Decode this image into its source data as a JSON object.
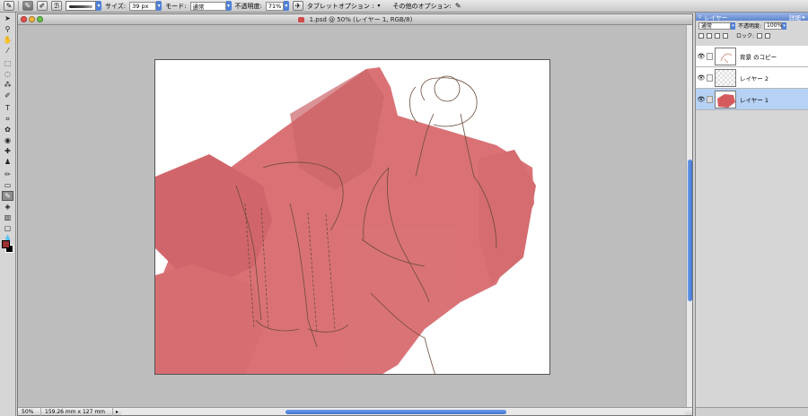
{
  "options_bar": {
    "size_label": "サイズ:",
    "size_value": "39 px",
    "mode_label": "モード:",
    "mode_value": "通常",
    "opacity_label": "不透明度:",
    "opacity_value": "71%",
    "tablet_label": "タブレットオプション :",
    "other_label": "その他のオプション:"
  },
  "document": {
    "title": "1.psd @ 50% (レイヤー 1, RGB/8)",
    "zoom": "50%",
    "doc_size": "159.26 mm x 127 mm"
  },
  "colors": {
    "foreground": "#9a3232",
    "background": "#000000",
    "sofa_fill": "#d45a5e",
    "selection": "#b6d1f4"
  },
  "layers_panel": {
    "title": "レイヤー",
    "more_label": "詳細",
    "blend_mode": "通常",
    "opacity_label": "不透明度:",
    "opacity_value": "100%",
    "lock_label": "ロック:",
    "layers": [
      {
        "name": "背景 のコピー",
        "visible": true,
        "selected": false
      },
      {
        "name": "レイヤー 2",
        "visible": true,
        "selected": false
      },
      {
        "name": "レイヤー 1",
        "visible": true,
        "selected": true
      }
    ]
  }
}
